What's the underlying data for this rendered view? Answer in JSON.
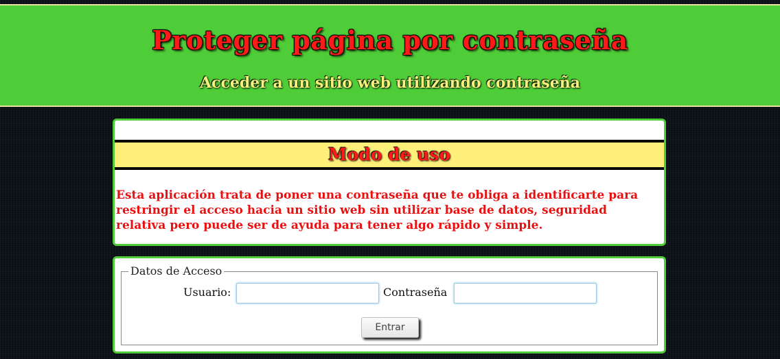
{
  "header": {
    "title": "Proteger página por contraseña",
    "subtitle": "Acceder a un sitio web utilizando contraseña"
  },
  "usage": {
    "title": "Modo de uso",
    "text": "Esta aplicación trata de poner una contraseña que te obliga a identificarte para restringir el acceso hacia un sitio web sin utilizar base de datos, seguridad relativa pero puede ser de ayuda para tener algo rápido y simple."
  },
  "login": {
    "legend": "Datos de Acceso",
    "user_label": "Usuario:",
    "user_value": "",
    "password_label": "Contraseña",
    "password_value": "",
    "submit_label": "Entrar"
  },
  "colors": {
    "header_green": "#4fcd38",
    "title_red": "#ff1a1a",
    "subtitle_yellow": "#f7f07a",
    "band_yellow": "#fff07a",
    "text_red": "#e81010"
  }
}
